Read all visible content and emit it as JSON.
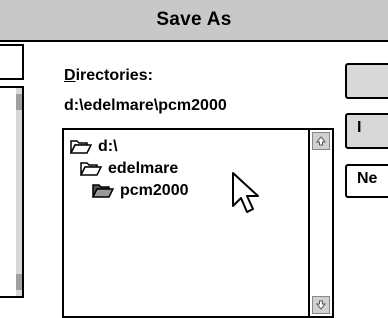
{
  "window": {
    "title": "Save As"
  },
  "directories": {
    "label_mnemonic": "D",
    "label_rest": "irectories:",
    "current_path": "d:\\edelmare\\pcm2000",
    "items": [
      {
        "label": "d:\\",
        "icon": "open-folder-icon"
      },
      {
        "label": "edelmare",
        "icon": "open-folder-icon"
      },
      {
        "label": "pcm2000",
        "icon": "open-folder-selected-icon"
      }
    ]
  },
  "buttons": {
    "b1_label": "",
    "b2_label": "I",
    "b3_label": "Ne"
  },
  "colors": {
    "titlebar_bg": "#c8c8c8",
    "button_face": "#d8d8d8",
    "scroll_button": "#d0d0d0"
  }
}
